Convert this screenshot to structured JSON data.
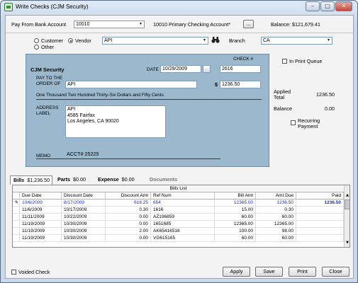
{
  "window": {
    "title": "Write Checks  (CJM Security)"
  },
  "header": {
    "pay_from_label": "Pay From Bank Account",
    "bank_account": "10010",
    "bank_account_name": "10010 Primary Checking Account*",
    "browse_label": "...",
    "balance": "Balance: $121,679.41"
  },
  "payee": {
    "customer_label": "Customer",
    "vendor_label": "Vendor",
    "other_label": "Other",
    "selected_type": "Vendor",
    "vendor": "API",
    "branch_label": "Branch",
    "branch": "CA",
    "in_print_queue_label": "In Print Queue"
  },
  "check": {
    "company": "CJM Security",
    "check_no_label": "CHECK #",
    "check_no": "2616",
    "date_label": "DATE",
    "date": "10/29/2009",
    "pay_to_label_1": "PAY TO THE",
    "pay_to_label_2": "ORDER OF",
    "pay_to": "API",
    "dollar_sign": "$",
    "amount": "1236.50",
    "amount_words": "One Thousand Two Hundred Thirty-Six Dollars and Fifty Cents",
    "address_label_1": "ADDRESS",
    "address_label_2": "LABEL",
    "address_lines": [
      "API",
      "4585 Fairfax",
      "Los Angeles, CA  90020"
    ],
    "memo_label": "MEMO",
    "memo": "ACCT# 25225"
  },
  "totals": {
    "applied_label_1": "Applied",
    "applied_label_2": "Total",
    "applied_total": "1236.50",
    "balance_label": "Balance",
    "balance": "0.00",
    "recurring_label_1": "Recurring",
    "recurring_label_2": "Payment"
  },
  "tabs": [
    {
      "label": "Bills",
      "value": "$1,236.50"
    },
    {
      "label": "Parts",
      "value": "$0.00"
    },
    {
      "label": "Expense",
      "value": "$0.00"
    },
    {
      "label": "Documents",
      "value": ""
    }
  ],
  "bills": {
    "title": "Bills List",
    "columns": [
      "Due Date",
      "Discount Date",
      "Discount Amt",
      "Ref Num",
      "Bill Amt",
      "Amt Due",
      "Paid"
    ],
    "rows": [
      [
        "10/6/2009",
        "8/17/2009",
        "618.25",
        "654",
        "12365.00",
        "1236.50",
        "1236.50"
      ],
      [
        "11/6/2009",
        "10/17/2009",
        "0.30",
        "1616",
        "15.00",
        "0.30",
        ""
      ],
      [
        "11/11/2009",
        "10/22/2009",
        "0.00",
        "AZ196859",
        "60.00",
        "60.00",
        ""
      ],
      [
        "11/19/2009",
        "10/30/2009",
        "0.00",
        "1651685",
        "12365.00",
        "12365.00",
        ""
      ],
      [
        "11/19/2009",
        "10/30/2009",
        "2.00",
        "AK65416516",
        "100.00",
        "98.00",
        ""
      ],
      [
        "11/19/2009",
        "10/30/2009",
        "0.00",
        "VG615165",
        "60.00",
        "60.00",
        ""
      ]
    ]
  },
  "footer": {
    "voided_label": "Voided Check",
    "apply": "Apply",
    "save": "Save",
    "print": "Print",
    "close": "Close"
  },
  "icons": [
    "app-icon",
    "minimize-icon",
    "maximize-icon",
    "close-icon",
    "binoculars-icon",
    "calendar-icon",
    "dropdown-arrow-icon",
    "row-edit-icon",
    "scroll-up-icon",
    "scroll-down-icon"
  ]
}
